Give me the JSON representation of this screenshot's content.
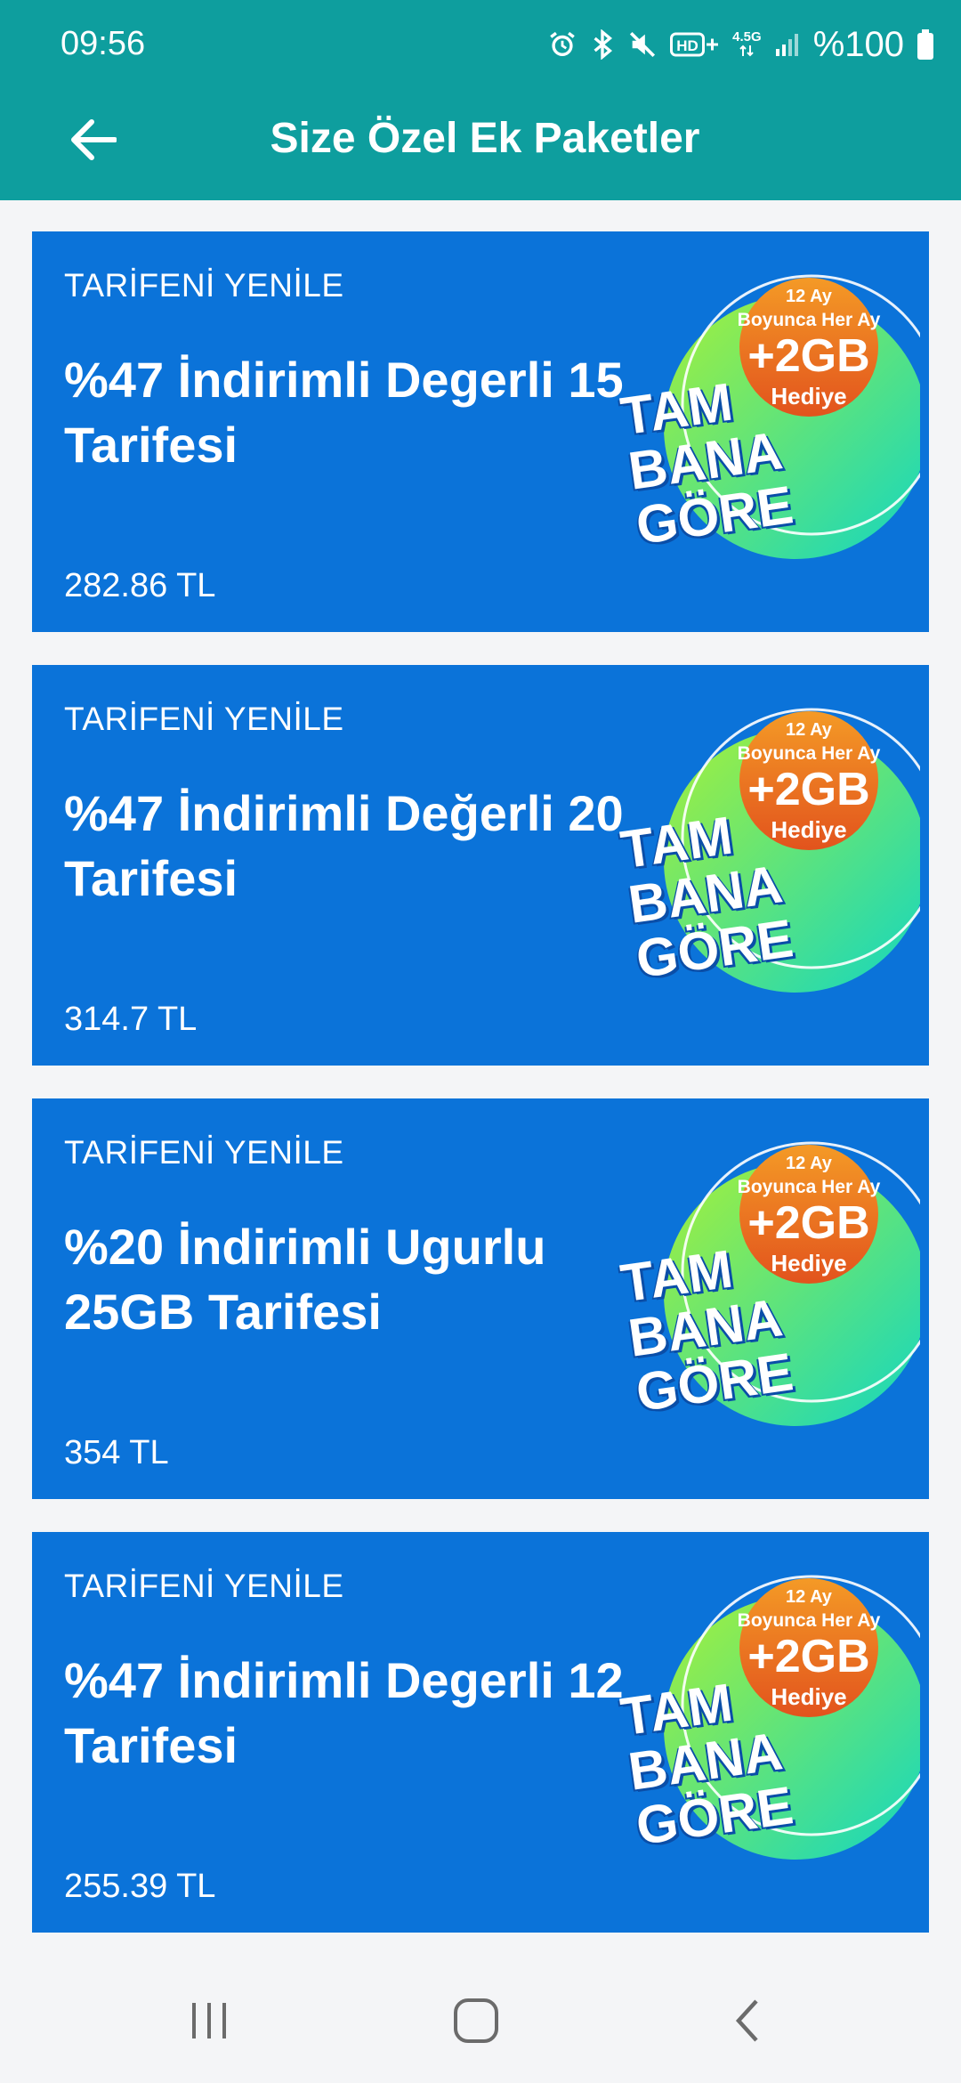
{
  "status_bar": {
    "time": "09:56",
    "network_label": "4.5G",
    "battery_text": "%100",
    "icons": [
      "alarm-icon",
      "bluetooth-icon",
      "mute-icon",
      "hd-plus-icon",
      "network-4.5g-icon",
      "signal-icon",
      "battery-icon"
    ]
  },
  "header": {
    "title": "Size Özel Ek Paketler",
    "back_icon": "arrow-left-icon"
  },
  "colors": {
    "header_bg": "#0e9e9e",
    "card_bg": "#0b73d9",
    "page_bg": "#f4f5f7",
    "badge_orange": "#ea6a1f",
    "badge_green": "#19d9a8"
  },
  "promo": {
    "line1": "12 Ay",
    "line2": "Boyunca Her Ay",
    "amount": "+2GB",
    "gift": "Hediye",
    "slogan1": "TAM",
    "slogan2": "BANA",
    "slogan3": "GÖRE"
  },
  "cards": [
    {
      "kicker": "TARİFENİ YENİLE",
      "title": "%47 İndirimli Degerli 15 Tarifesi",
      "price": "282.86 TL"
    },
    {
      "kicker": "TARİFENİ YENİLE",
      "title": "%47 İndirimli Değerli 20 Tarifesi",
      "price": "314.7 TL"
    },
    {
      "kicker": "TARİFENİ YENİLE",
      "title": "%20 İndirimli Ugurlu 25GB Tarifesi",
      "price": "354 TL"
    },
    {
      "kicker": "TARİFENİ YENİLE",
      "title": "%47 İndirimli Degerli 12 Tarifesi",
      "price": "255.39 TL"
    }
  ],
  "nav": [
    "recent-apps-icon",
    "home-icon",
    "back-icon"
  ]
}
